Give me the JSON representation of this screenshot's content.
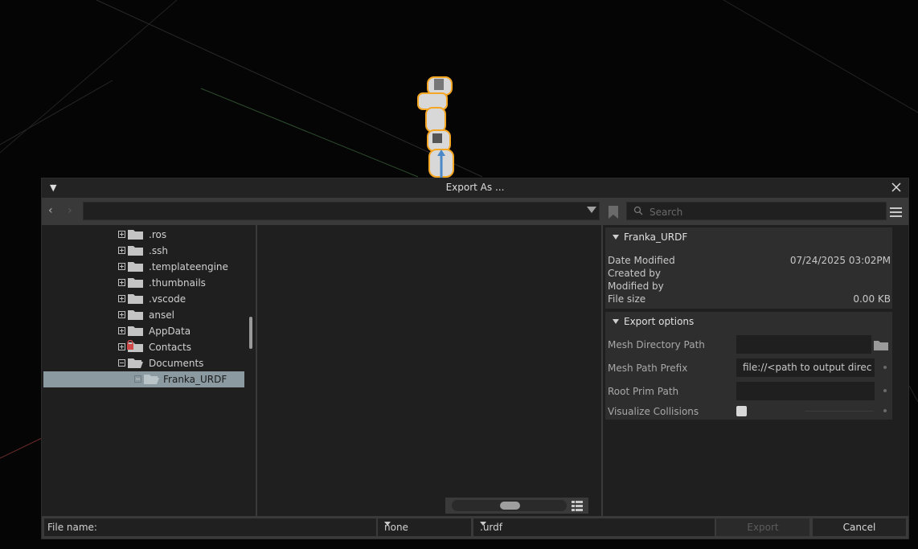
{
  "dialog": {
    "title": "Export As ..."
  },
  "toolbar": {
    "path_value": "",
    "search_placeholder": "Search"
  },
  "tree": {
    "items": [
      {
        "label": ".ros",
        "state": "collapsed"
      },
      {
        "label": ".ssh",
        "state": "collapsed"
      },
      {
        "label": ".templateengine",
        "state": "collapsed"
      },
      {
        "label": ".thumbnails",
        "state": "collapsed"
      },
      {
        "label": ".vscode",
        "state": "collapsed"
      },
      {
        "label": "ansel",
        "state": "collapsed"
      },
      {
        "label": "AppData",
        "state": "collapsed"
      },
      {
        "label": "Contacts",
        "state": "collapsed",
        "locked": true
      },
      {
        "label": "Documents",
        "state": "expanded"
      },
      {
        "label": "Franka_URDF",
        "state": "selected"
      }
    ]
  },
  "info": {
    "header": "Franka_URDF",
    "rows": [
      {
        "label": "Date Modified",
        "value": "07/24/2025 03:02PM"
      },
      {
        "label": "Created by",
        "value": ""
      },
      {
        "label": "Modified by",
        "value": ""
      },
      {
        "label": "File size",
        "value": "0.00 KB"
      }
    ]
  },
  "export_options": {
    "header": "Export options",
    "mesh_dir_label": "Mesh Directory Path",
    "mesh_dir_value": "",
    "mesh_prefix_label": "Mesh Path Prefix",
    "mesh_prefix_value": "file://<path to output directory>",
    "root_prim_label": "Root Prim Path",
    "root_prim_value": "",
    "visualize_label": "Visualize Collisions",
    "visualize_checked": false
  },
  "footer": {
    "filename_label": "File name:",
    "filename_value": "",
    "filter_value": "none",
    "extension_value": ".urdf",
    "export_label": "Export",
    "cancel_label": "Cancel"
  },
  "colors": {
    "robot_outline": "#f5a623",
    "selection": "#8a9aa0",
    "panel": "#2e2e2e"
  }
}
